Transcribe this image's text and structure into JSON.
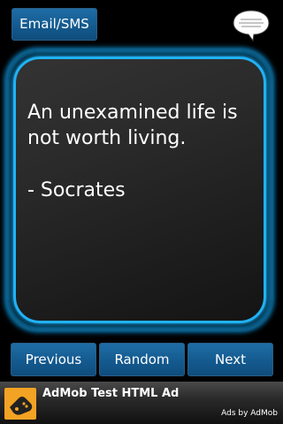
{
  "header": {
    "email_sms_label": "Email/SMS",
    "bubble_icon": "speech-bubble-icon"
  },
  "quote": {
    "text": "An unexamined life is not worth living.",
    "author": "- Socrates"
  },
  "navigation": {
    "previous_label": "Previous",
    "random_label": "Random",
    "next_label": "Next"
  },
  "ad": {
    "icon": "game-controller-icon",
    "title": "AdMob Test HTML Ad",
    "credit": "Ads by AdMob",
    "icon_color": "#f3a323"
  },
  "colors": {
    "button_blue": "#145a8f",
    "card_border": "#20b2f5",
    "background": "#000000"
  }
}
